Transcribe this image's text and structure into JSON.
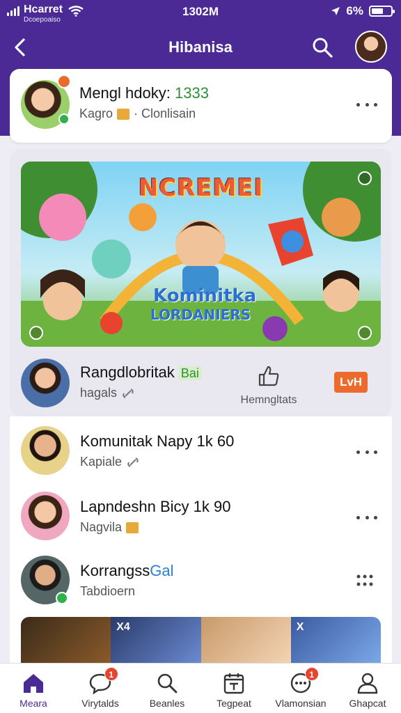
{
  "status_bar": {
    "carrier": "Hcarret",
    "carrier_sub": "Dcoepoaiso",
    "time": "1302M",
    "battery": "6%",
    "battery_level": 0.6
  },
  "nav": {
    "title": "Hibanisa",
    "icons": [
      "back-arrow-icon",
      "search-icon"
    ]
  },
  "top_card": {
    "name": "Mengl hdoky:",
    "name_count": "1333",
    "sub_left": "Kagro",
    "sub_right": "· Clonlisain",
    "badge_color": "#ec6a2c",
    "online_color": "#2fb14a"
  },
  "banner": {
    "title": "NCREMEI",
    "subtitle": "Kominitka",
    "subtitle2": "LORDANIERS"
  },
  "featured_row": {
    "name": "Rangdlobritak",
    "tag": "Bai",
    "sub": "hagals",
    "like_label": "Hemngltats",
    "live_badge": "LvH"
  },
  "list": [
    {
      "name": "Komunitak Napy 1k 60",
      "sub": "Kapiale"
    },
    {
      "name": "Lapndeshn Bicy 1k 90",
      "sub": "Nagvila"
    },
    {
      "name": "Korrangss",
      "name_tag": "Gal",
      "sub": "Tabdioern"
    }
  ],
  "strip": {
    "labels": [
      "X4",
      "",
      "",
      "X"
    ]
  },
  "tabs": [
    {
      "label": "Meara",
      "icon": "home-icon",
      "badge": ""
    },
    {
      "label": "Virytalds",
      "icon": "chat-bubble-icon",
      "badge": "1"
    },
    {
      "label": "Beanles",
      "icon": "search-icon",
      "badge": ""
    },
    {
      "label": "Tegpeat",
      "icon": "calendar-icon",
      "badge": ""
    },
    {
      "label": "Vlamonsian",
      "icon": "message-icon",
      "badge": "1"
    },
    {
      "label": "Ghapcat",
      "icon": "person-icon",
      "badge": ""
    }
  ],
  "colors": {
    "header_purple": "#4b2a95",
    "live_orange": "#ec6a2c",
    "badge_red": "#e8432e"
  }
}
